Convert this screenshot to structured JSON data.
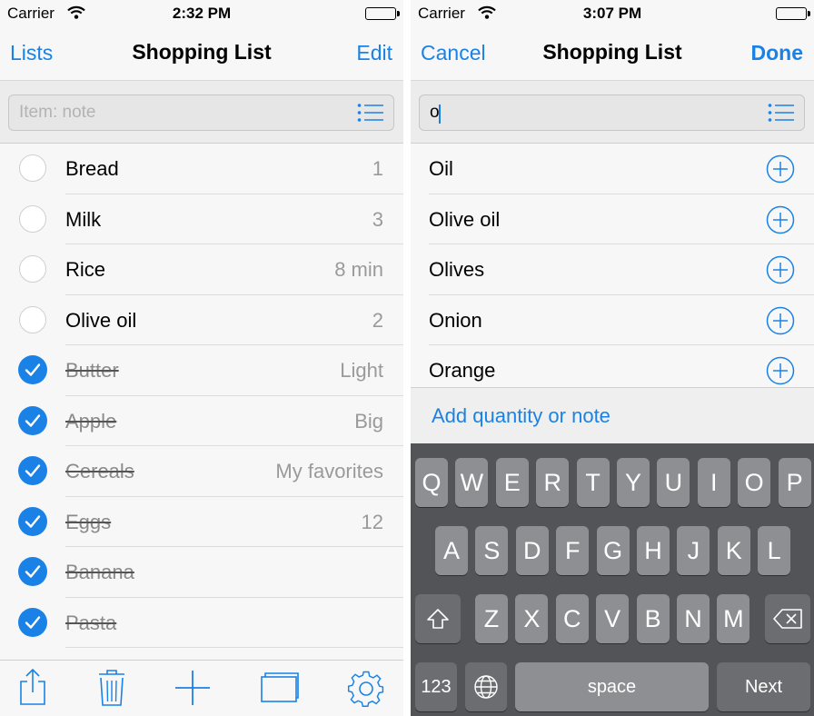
{
  "left": {
    "status": {
      "carrier": "Carrier",
      "time": "2:32 PM"
    },
    "nav": {
      "back": "Lists",
      "title": "Shopping List",
      "action": "Edit"
    },
    "search": {
      "placeholder": "Item: note",
      "value": ""
    },
    "items": [
      {
        "name": "Bread",
        "note": "1",
        "checked": false
      },
      {
        "name": "Milk",
        "note": "3",
        "checked": false
      },
      {
        "name": "Rice",
        "note": "8 min",
        "checked": false
      },
      {
        "name": "Olive oil",
        "note": "2",
        "checked": false
      },
      {
        "name": "Butter",
        "note": "Light",
        "checked": true
      },
      {
        "name": "Apple",
        "note": "Big",
        "checked": true
      },
      {
        "name": "Cereals",
        "note": "My favorites",
        "checked": true
      },
      {
        "name": "Eggs",
        "note": "12",
        "checked": true
      },
      {
        "name": "Banana",
        "note": "",
        "checked": true
      },
      {
        "name": "Pasta",
        "note": "",
        "checked": true
      }
    ],
    "toolbar": [
      "share-icon",
      "trash-icon",
      "plus-icon",
      "folders-icon",
      "gear-icon"
    ]
  },
  "right": {
    "status": {
      "carrier": "Carrier",
      "time": "3:07 PM"
    },
    "nav": {
      "back": "Cancel",
      "title": "Shopping List",
      "action": "Done"
    },
    "search": {
      "value": "o"
    },
    "suggestions": [
      "Oil",
      "Olive oil",
      "Olives",
      "Onion",
      "Orange"
    ],
    "add_note": "Add quantity or note",
    "keyboard": {
      "row1": [
        "Q",
        "W",
        "E",
        "R",
        "T",
        "Y",
        "U",
        "I",
        "O",
        "P"
      ],
      "row2": [
        "A",
        "S",
        "D",
        "F",
        "G",
        "H",
        "J",
        "K",
        "L"
      ],
      "row3": [
        "Z",
        "X",
        "C",
        "V",
        "B",
        "N",
        "M"
      ],
      "numbers_key": "123",
      "space_key": "space",
      "next_key": "Next"
    }
  },
  "colors": {
    "accent": "#1a82e6",
    "keyboard_bg": "#525458",
    "key_bg": "#8d8f93"
  }
}
